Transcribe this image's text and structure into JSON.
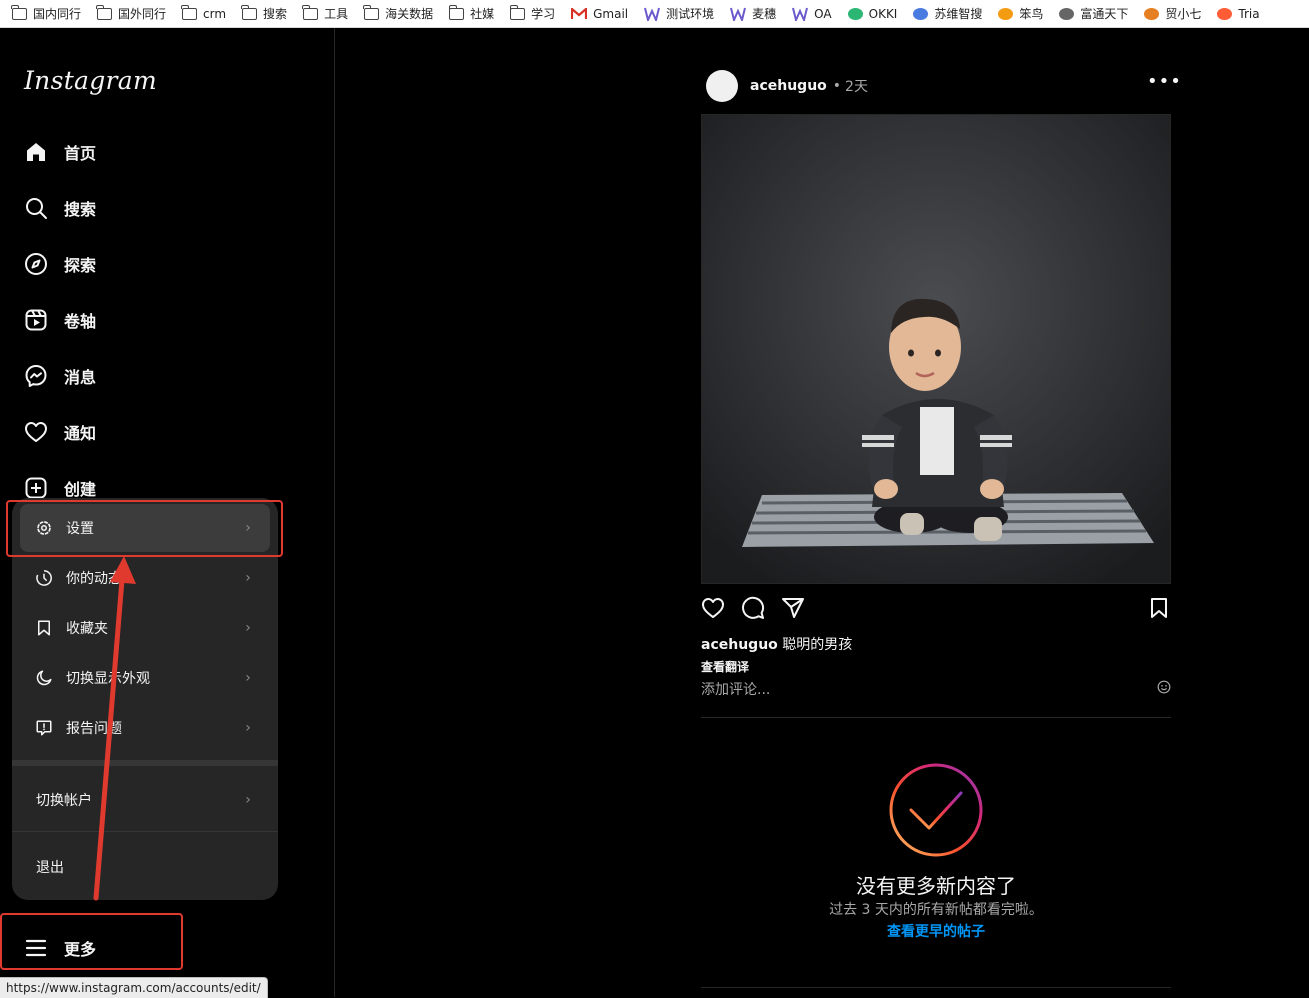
{
  "bookmarks": [
    {
      "label": "国内同行",
      "icon": "folder-icon"
    },
    {
      "label": "国外同行",
      "icon": "folder-icon"
    },
    {
      "label": "crm",
      "icon": "folder-icon"
    },
    {
      "label": "搜索",
      "icon": "folder-icon"
    },
    {
      "label": "工具",
      "icon": "folder-icon"
    },
    {
      "label": "海关数据",
      "icon": "folder-icon"
    },
    {
      "label": "社媒",
      "icon": "folder-icon"
    },
    {
      "label": "学习",
      "icon": "folder-icon"
    },
    {
      "label": "Gmail",
      "icon": "gmail-icon",
      "color": "#d93025"
    },
    {
      "label": "测试环境",
      "icon": "w-icon",
      "color": "#6a5acd"
    },
    {
      "label": "麦穗",
      "icon": "w-icon",
      "color": "#6a5acd"
    },
    {
      "label": "OA",
      "icon": "w-icon",
      "color": "#6a5acd"
    },
    {
      "label": "OKKI",
      "icon": "okki-icon",
      "color": "#2bb673"
    },
    {
      "label": "苏维智搜",
      "icon": "doc-icon",
      "color": "#4a7be0"
    },
    {
      "label": "笨鸟",
      "icon": "bird-icon",
      "color": "#f39c12"
    },
    {
      "label": "富通天下",
      "icon": "globe-icon",
      "color": "#666666"
    },
    {
      "label": "贸小七",
      "icon": "fox-icon",
      "color": "#e67e22"
    },
    {
      "label": "Tria",
      "icon": "hubspot-icon",
      "color": "#ff5c35"
    }
  ],
  "sidebar": {
    "logo": "Instagram",
    "items": [
      {
        "label": "首页",
        "icon": "home-icon"
      },
      {
        "label": "搜索",
        "icon": "search-icon"
      },
      {
        "label": "探索",
        "icon": "explore-icon"
      },
      {
        "label": "卷轴",
        "icon": "reels-icon"
      },
      {
        "label": "消息",
        "icon": "messenger-icon"
      },
      {
        "label": "通知",
        "icon": "heart-icon"
      },
      {
        "label": "创建",
        "icon": "create-icon"
      }
    ],
    "more_label": "更多"
  },
  "menu": {
    "items": [
      {
        "label": "设置",
        "icon": "gear-icon"
      },
      {
        "label": "你的动态",
        "icon": "activity-icon"
      },
      {
        "label": "收藏夹",
        "icon": "bookmark-icon"
      },
      {
        "label": "切换显示外观",
        "icon": "moon-icon"
      },
      {
        "label": "报告问题",
        "icon": "report-icon"
      }
    ],
    "switch_account": "切换帐户",
    "logout": "退出"
  },
  "status_url": "https://www.instagram.com/accounts/edit/",
  "post": {
    "username": "acehuguo",
    "time": "2天",
    "caption_user": "acehuguo",
    "caption_text": "聪明的男孩",
    "translate": "查看翻译",
    "comment_placeholder": "添加评论..."
  },
  "caught_up": {
    "title": "没有更多新内容了",
    "subtitle": "过去 3 天内的所有新帖都看完啦。",
    "link": "查看更早的帖子"
  },
  "colors": {
    "annotation_red": "#e03a2f",
    "link_blue": "#0095f6",
    "bg": "#000000",
    "menu_bg": "#262626"
  }
}
